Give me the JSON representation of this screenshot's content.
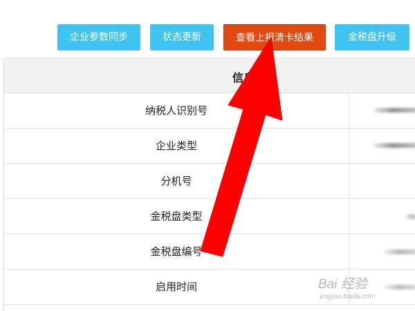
{
  "toolbar": {
    "buttons": [
      {
        "label": "企业参数同步"
      },
      {
        "label": "状态更新"
      },
      {
        "label": "查看上报清卡结果"
      },
      {
        "label": "金税盘升级"
      }
    ]
  },
  "panel": {
    "title": "信息",
    "rows": [
      {
        "label": "纳税人识别号"
      },
      {
        "label": "企业类型"
      },
      {
        "label": "分机号"
      },
      {
        "label": "金税盘类型"
      },
      {
        "label": "金税盘编号"
      },
      {
        "label": "启用时间"
      }
    ]
  },
  "annotation": {
    "arrow_color": "#ff0000"
  },
  "watermark": {
    "text": "Bai 经验",
    "subtext": "jingyan.baidu.com"
  },
  "colors": {
    "button_blue": "#3fc3f0",
    "button_orange": "#e24a12"
  }
}
